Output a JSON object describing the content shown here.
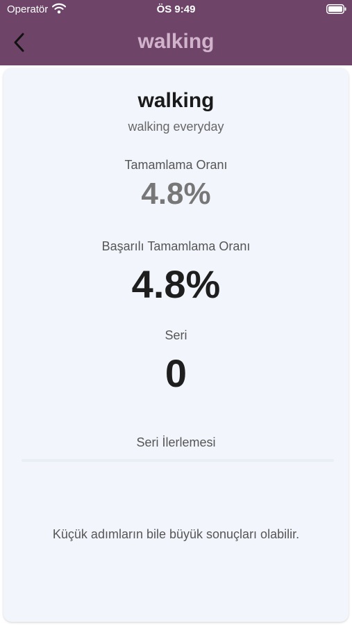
{
  "status_bar": {
    "carrier": "Operatör",
    "time": "ÖS 9:49",
    "icons": [
      "wifi-icon",
      "battery-icon"
    ]
  },
  "nav": {
    "title": "walking",
    "back_icon": "chevron-left-icon"
  },
  "habit": {
    "name": "walking",
    "description": "walking everyday"
  },
  "stats": {
    "completion_label": "Tamamlama Oranı",
    "completion_value": "4.8%",
    "success_label": "Başarılı Tamamlama Oranı",
    "success_value": "4.8%",
    "streak_label": "Seri",
    "streak_value": "0"
  },
  "progress": {
    "label": "Seri İlerlemesi",
    "fraction": 0
  },
  "motivation": "Küçük adımların bile büyük sonuçları olabilir.",
  "colors": {
    "header": "#6e4568",
    "nav_title": "#d1b3cb",
    "card_bg": "#f2f6fc"
  }
}
